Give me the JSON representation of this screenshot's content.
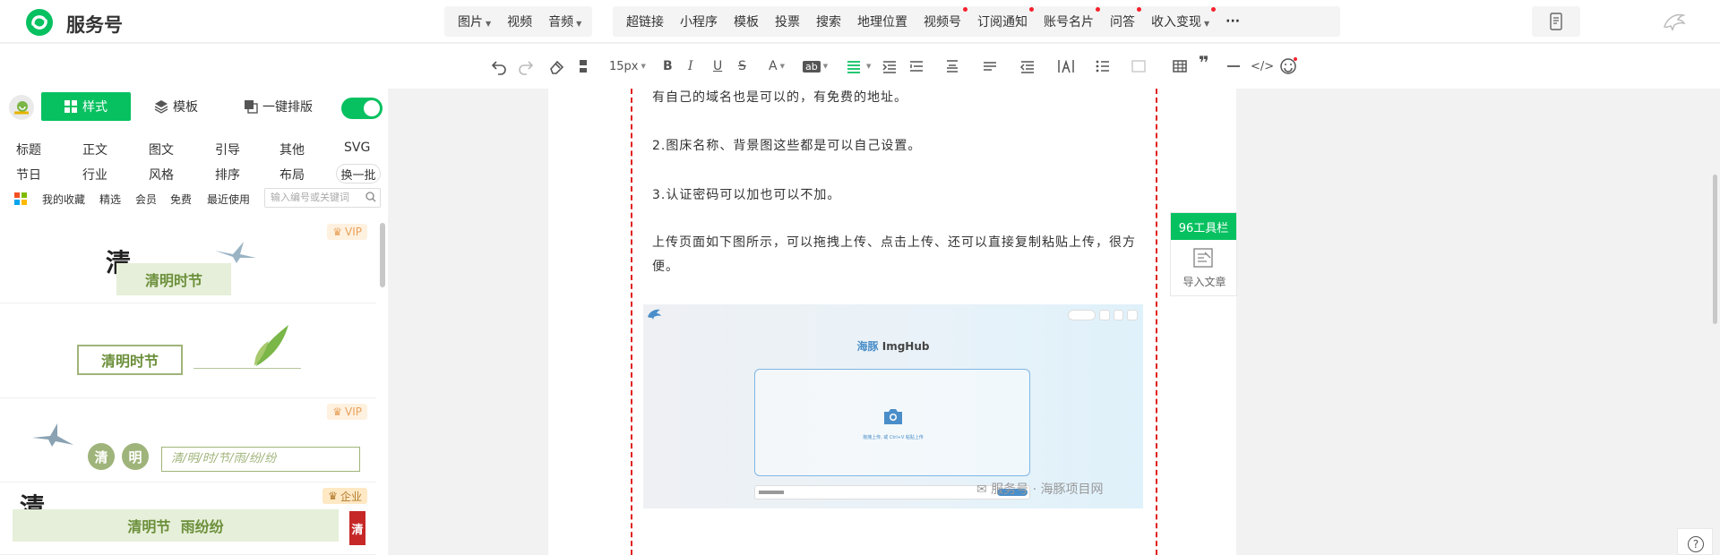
{
  "app": {
    "brand": "服务号"
  },
  "menu_group_media": [
    {
      "label": "图片",
      "dropdown": true
    },
    {
      "label": "视频",
      "dropdown": false
    },
    {
      "label": "音频",
      "dropdown": true
    }
  ],
  "menu_group_insert": [
    {
      "label": "超链接",
      "dot": false
    },
    {
      "label": "小程序",
      "dot": false
    },
    {
      "label": "模板",
      "dot": false
    },
    {
      "label": "投票",
      "dot": false
    },
    {
      "label": "搜索",
      "dot": false
    },
    {
      "label": "地理位置",
      "dot": false
    },
    {
      "label": "视频号",
      "dot": true
    },
    {
      "label": "订阅通知",
      "dot": true
    },
    {
      "label": "账号名片",
      "dot": true
    },
    {
      "label": "问答",
      "dot": true
    },
    {
      "label": "收入变现",
      "dot": true,
      "dropdown": true
    }
  ],
  "more_label": "···",
  "toolbar": {
    "font_size": "15px"
  },
  "sidebar": {
    "tabs": {
      "style": "样式",
      "template": "模板",
      "one_click": "一键排版"
    },
    "categories_row1": [
      "标题",
      "正文",
      "图文",
      "引导",
      "其他",
      "SVG"
    ],
    "categories_row2": [
      "节日",
      "行业",
      "风格",
      "排序",
      "布局"
    ],
    "swap_label": "换一批",
    "sub_tabs": [
      "我的收藏",
      "精选",
      "会员",
      "免费",
      "最近使用"
    ],
    "search_placeholder": "输入编号或关键词",
    "templates": [
      {
        "badge": "VIP",
        "title": "清明时节"
      },
      {
        "badge": "",
        "title": "清明时节"
      },
      {
        "badge": "VIP",
        "circle1": "清",
        "circle2": "明",
        "line": "清/明/时/节/雨/纷/纷"
      },
      {
        "badge": "企业",
        "title": "清明节  雨纷纷",
        "corner_char": "清"
      }
    ]
  },
  "editor": {
    "paragraphs": [
      "有自己的域名也是可以的，有免费的地址。",
      "2.图床名称、背景图这些都是可以自己设置。",
      "3.认证密码可以加也可以不加。",
      "上传页面如下图所示，可以拖拽上传、点击上传、还可以直接复制粘贴上传，很方便。"
    ],
    "image": {
      "title_prefix": "海豚",
      "title_suffix": " ImgHub",
      "hint": "拖拽上传, 或 Ctrl+V 粘贴上传",
      "watermark": "服务号 · 海豚项目网"
    }
  },
  "side_panel": {
    "toolbar_label": "96工具栏",
    "import_label": "导入文章"
  },
  "help_label": "?"
}
